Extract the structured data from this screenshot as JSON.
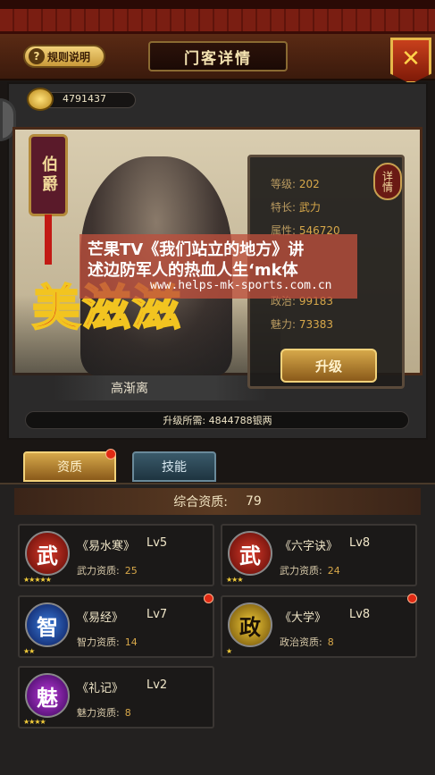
{
  "header": {
    "rules_label": "规则说明",
    "title": "门客详情",
    "close_glyph": "✕"
  },
  "currency": {
    "value": "4791437"
  },
  "hero": {
    "rank_title": "伯爵",
    "name": "高渐离",
    "display_name": "美滋滋",
    "stats": [
      {
        "label": "等级:",
        "value": "202"
      },
      {
        "label": "特长:",
        "value": "武力"
      },
      {
        "label": "属性:",
        "value": "546720"
      },
      {
        "label": "政治:",
        "value": "99183"
      },
      {
        "label": "魅力:",
        "value": "73383"
      }
    ],
    "detail_label": "详情",
    "upgrade_label": "升级",
    "upgrade_need": "升级所需: 4844788银两"
  },
  "watermark": {
    "line1": "芒果TV《我们站立的地方》讲",
    "line2": "述边防军人的热血人生‘mk体",
    "url": "www.helps-mk-sports.com.cn"
  },
  "tabs": [
    {
      "label": "资质"
    },
    {
      "label": "技能"
    }
  ],
  "summary": {
    "label": "综合资质:",
    "value": "79"
  },
  "cards": [
    {
      "emblem": "武",
      "book": "《易水寒》",
      "level": "Lv5",
      "attr": "武力资质:",
      "attr_value": "25",
      "stars": "★★★★★",
      "color": "#a01a14"
    },
    {
      "emblem": "武",
      "book": "《六字诀》",
      "level": "Lv8",
      "attr": "武力资质:",
      "attr_value": "24",
      "stars": "★★★",
      "color": "#a01a14"
    },
    {
      "emblem": "智",
      "book": "《易经》",
      "level": "Lv7",
      "attr": "智力资质:",
      "attr_value": "14",
      "stars": "★★",
      "color": "#1a4aa0"
    },
    {
      "emblem": "政",
      "book": "《大学》",
      "level": "Lv8",
      "attr": "政治资质:",
      "attr_value": "8",
      "stars": "★",
      "color": "#b08a1a"
    },
    {
      "emblem": "魅",
      "book": "《礼记》",
      "level": "Lv2",
      "attr": "魅力资质:",
      "attr_value": "8",
      "stars": "★★★★",
      "color": "#7a1aa0"
    }
  ]
}
